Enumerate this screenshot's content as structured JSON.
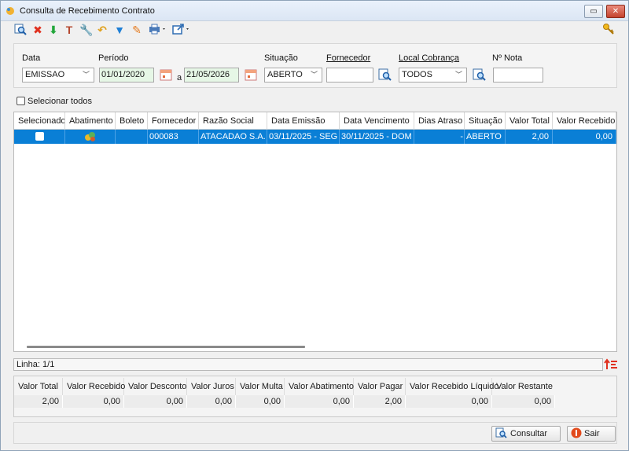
{
  "window": {
    "title": "Consulta de Recebimento Contrato"
  },
  "toolbar": {
    "icons": [
      "search-icon",
      "delete-icon",
      "download-icon",
      "format-icon",
      "wrench-icon",
      "undo-icon",
      "filter-icon",
      "edit-icon",
      "print-icon",
      "export-icon",
      "key-icon"
    ]
  },
  "filters": {
    "data_label": "Data",
    "data_value": "EMISSAO",
    "periodo_label": "Período",
    "periodo_from": "01/01/2020",
    "periodo_sep": "a",
    "periodo_to": "21/05/2026",
    "situacao_label": "Situação",
    "situacao_value": "ABERTO",
    "fornecedor_label": "Fornecedor",
    "fornecedor_value": "",
    "local_label": "Local Cobrança",
    "local_value": "TODOS",
    "nota_label": "Nº Nota",
    "nota_value": ""
  },
  "select_all_label": "Selecionar todos",
  "grid": {
    "columns": [
      "Selecionado",
      "Abatimento",
      "Boleto",
      "Fornecedor",
      "Razão Social",
      "Data Emissão",
      "Data Vencimento",
      "Dias Atraso",
      "Situação",
      "Valor Total",
      "Valor Recebido"
    ],
    "rows": [
      {
        "boleto": "",
        "fornecedor": "000083",
        "razao_social": "ATACADAO S.A.",
        "data_emissao": "03/11/2025 - SEG",
        "data_vencimento": "30/11/2025 - DOM",
        "dias_atraso": "-",
        "situacao": "ABERTO",
        "valor_total": "2,00",
        "valor_recebido": "0,00"
      }
    ]
  },
  "status": {
    "linha": "Linha: 1/1"
  },
  "totals": {
    "headers": [
      "Valor Total",
      "Valor Recebido",
      "Valor Desconto",
      "Valor Juros",
      "Valor Multa",
      "Valor Abatimento",
      "Valor Pagar",
      "Valor Recebido Líquido",
      "Valor Restante"
    ],
    "values": [
      "2,00",
      "0,00",
      "0,00",
      "0,00",
      "0,00",
      "0,00",
      "2,00",
      "0,00",
      "0,00"
    ]
  },
  "buttons": {
    "consultar": "Consultar",
    "sair": "Sair"
  },
  "colors": {
    "selection": "#0a7fd6",
    "date_field": "#e6f7e6",
    "delete": "#e0301e",
    "green": "#22a63a"
  }
}
